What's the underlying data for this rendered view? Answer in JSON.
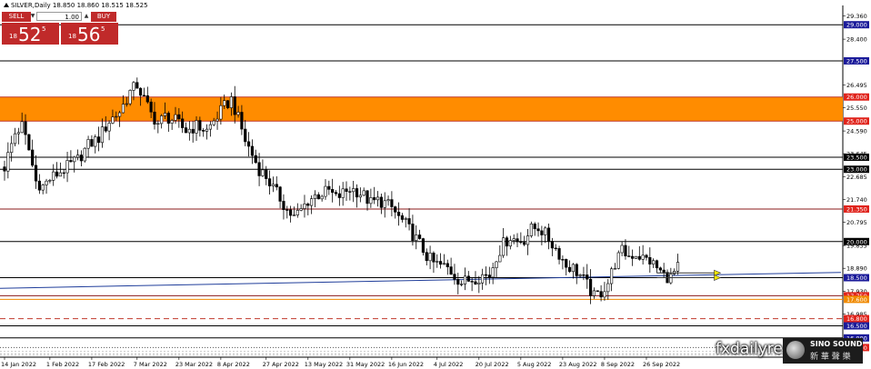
{
  "header": {
    "symbol_line": "SILVER,Daily  18.850 18.860 18.515 18.525"
  },
  "trade_panel": {
    "sell_label": "SELL",
    "buy_label": "BUY",
    "quantity": "1.00",
    "sell_prefix": "18",
    "sell_big": "52",
    "sell_sup": "5",
    "buy_prefix": "18",
    "buy_big": "56",
    "buy_sup": "5"
  },
  "watermark": {
    "text": "fxdailyre",
    "logo_line1": "SINO SOUND",
    "logo_line2": "新 華 聲 樂"
  },
  "chart_data": {
    "type": "candlestick",
    "title": "SILVER,Daily",
    "ylim": [
      15.2,
      29.8
    ],
    "y_tick_labels": [
      {
        "value": 29.36,
        "label": "29.360"
      },
      {
        "value": 28.4,
        "label": "28.400"
      },
      {
        "value": 26.495,
        "label": "26.495"
      },
      {
        "value": 25.55,
        "label": "25.550"
      },
      {
        "value": 24.59,
        "label": "24.590"
      },
      {
        "value": 23.645,
        "label": "23.645"
      },
      {
        "value": 22.685,
        "label": "22.685"
      },
      {
        "value": 21.74,
        "label": "21.740"
      },
      {
        "value": 20.795,
        "label": "20.795"
      },
      {
        "value": 19.835,
        "label": "19.835"
      },
      {
        "value": 18.89,
        "label": "18.890"
      },
      {
        "value": 17.93,
        "label": "17.930"
      },
      {
        "value": 16.985,
        "label": "16.985"
      }
    ],
    "x_tick_labels": [
      {
        "index": 0,
        "label": "14 Jan 2022"
      },
      {
        "index": 13,
        "label": "1 Feb 2022"
      },
      {
        "index": 25,
        "label": "17 Feb 2022"
      },
      {
        "index": 38,
        "label": "7 Mar 2022"
      },
      {
        "index": 50,
        "label": "23 Mar 2022"
      },
      {
        "index": 62,
        "label": "8 Apr 2022"
      },
      {
        "index": 75,
        "label": "27 Apr 2022"
      },
      {
        "index": 87,
        "label": "13 May 2022"
      },
      {
        "index": 99,
        "label": "31 May 2022"
      },
      {
        "index": 111,
        "label": "16 Jun 2022"
      },
      {
        "index": 124,
        "label": "4 Jul 2022"
      },
      {
        "index": 136,
        "label": "20 Jul 2022"
      },
      {
        "index": 148,
        "label": "5 Aug 2022"
      },
      {
        "index": 160,
        "label": "23 Aug 2022"
      },
      {
        "index": 172,
        "label": "8 Sep 2022"
      },
      {
        "index": 184,
        "label": "26 Sep 2022"
      }
    ],
    "close_path": [
      [
        0,
        23.1
      ],
      [
        3,
        24.5
      ],
      [
        5,
        24.8
      ],
      [
        7,
        23.8
      ],
      [
        9,
        22.5
      ],
      [
        11,
        22.3
      ],
      [
        13,
        22.6
      ],
      [
        15,
        22.8
      ],
      [
        18,
        23.1
      ],
      [
        21,
        23.4
      ],
      [
        24,
        24.0
      ],
      [
        27,
        24.3
      ],
      [
        30,
        25.0
      ],
      [
        33,
        25.4
      ],
      [
        36,
        26.2
      ],
      [
        38,
        26.5
      ],
      [
        40,
        25.9
      ],
      [
        42,
        25.3
      ],
      [
        44,
        24.9
      ],
      [
        46,
        25.2
      ],
      [
        49,
        25.0
      ],
      [
        52,
        24.6
      ],
      [
        55,
        24.8
      ],
      [
        58,
        24.6
      ],
      [
        61,
        25.2
      ],
      [
        63,
        25.6
      ],
      [
        65,
        25.9
      ],
      [
        67,
        25.1
      ],
      [
        69,
        24.2
      ],
      [
        71,
        23.6
      ],
      [
        73,
        23.0
      ],
      [
        75,
        22.7
      ],
      [
        77,
        22.2
      ],
      [
        79,
        21.8
      ],
      [
        81,
        21.3
      ],
      [
        83,
        21.0
      ],
      [
        85,
        21.3
      ],
      [
        87,
        21.7
      ],
      [
        89,
        21.9
      ],
      [
        91,
        22.0
      ],
      [
        93,
        22.1
      ],
      [
        95,
        21.8
      ],
      [
        97,
        22.0
      ],
      [
        99,
        22.2
      ],
      [
        101,
        22.1
      ],
      [
        103,
        21.9
      ],
      [
        105,
        21.6
      ],
      [
        107,
        21.7
      ],
      [
        109,
        21.6
      ],
      [
        111,
        21.4
      ],
      [
        113,
        21.0
      ],
      [
        115,
        20.7
      ],
      [
        117,
        20.3
      ],
      [
        119,
        19.9
      ],
      [
        121,
        19.4
      ],
      [
        123,
        19.1
      ],
      [
        125,
        19.0
      ],
      [
        127,
        18.9
      ],
      [
        129,
        18.6
      ],
      [
        131,
        18.3
      ],
      [
        133,
        18.4
      ],
      [
        135,
        18.5
      ],
      [
        137,
        18.6
      ],
      [
        139,
        18.6
      ],
      [
        141,
        19.4
      ],
      [
        143,
        19.9
      ],
      [
        145,
        20.2
      ],
      [
        147,
        20.0
      ],
      [
        149,
        20.1
      ],
      [
        151,
        20.5
      ],
      [
        153,
        20.6
      ],
      [
        155,
        20.3
      ],
      [
        157,
        19.9
      ],
      [
        159,
        19.5
      ],
      [
        161,
        19.0
      ],
      [
        163,
        18.9
      ],
      [
        165,
        18.6
      ],
      [
        167,
        18.2
      ],
      [
        169,
        17.7
      ],
      [
        171,
        17.9
      ],
      [
        173,
        18.3
      ],
      [
        175,
        19.1
      ],
      [
        177,
        19.6
      ],
      [
        179,
        19.4
      ],
      [
        181,
        19.5
      ],
      [
        183,
        19.3
      ],
      [
        185,
        19.2
      ],
      [
        187,
        18.9
      ],
      [
        189,
        18.6
      ],
      [
        191,
        18.5
      ],
      [
        193,
        18.9
      ]
    ],
    "horizontal_levels": [
      {
        "value": 29.0,
        "label": "29.000",
        "color": "#1b1b9a",
        "line": "solid-black"
      },
      {
        "value": 27.5,
        "label": "27.500",
        "color": "#1b1b9a",
        "line": "solid-black"
      },
      {
        "value": 26.0,
        "label": "26.000",
        "color": "#e0241c",
        "line": "zone-top"
      },
      {
        "value": 25.0,
        "label": "25.000",
        "color": "#e0241c",
        "line": "zone-bottom"
      },
      {
        "value": 23.5,
        "label": "23.500",
        "color": "#000000",
        "line": "solid-black"
      },
      {
        "value": 23.0,
        "label": "23.000",
        "color": "#000000",
        "line": "solid-black"
      },
      {
        "value": 21.35,
        "label": "21.350",
        "color": "#e0241c",
        "line": "dark-red"
      },
      {
        "value": 20.0,
        "label": "20.000",
        "color": "#000000",
        "line": "solid-black"
      },
      {
        "value": 18.5,
        "label": "18.500",
        "color": "#1b1b9a",
        "line": "solid-black"
      },
      {
        "value": 17.75,
        "label": "17.750",
        "color": "#e0241c",
        "line": "dark-red"
      },
      {
        "value": 17.6,
        "label": "17.600",
        "color": "#f08a00",
        "line": "orange"
      },
      {
        "value": 16.8,
        "label": "16.800",
        "color": "#e0241c",
        "line": "red-dashed"
      },
      {
        "value": 16.5,
        "label": "16.500",
        "color": "#1b1b9a",
        "line": "solid-black"
      },
      {
        "value": 16.0,
        "label": "16.000",
        "color": "#1b1b9a",
        "line": "solid-black"
      },
      {
        "value": 15.6,
        "label": "15.600",
        "color": "#e0241c",
        "line": "dotted"
      }
    ],
    "supply_zone": {
      "from": 25.0,
      "to": 26.0,
      "color": "#ff8c00"
    },
    "trendline": {
      "from": [
        0,
        18.0
      ],
      "to": [
        193,
        18.7
      ],
      "color": "#1f3d9a"
    },
    "arrows": [
      {
        "from": [
          186,
          18.7
        ],
        "to": [
          193,
          18.7
        ]
      },
      {
        "from": [
          186,
          18.5
        ],
        "to": [
          193,
          18.5
        ]
      }
    ],
    "grid": false,
    "legend": "none"
  }
}
